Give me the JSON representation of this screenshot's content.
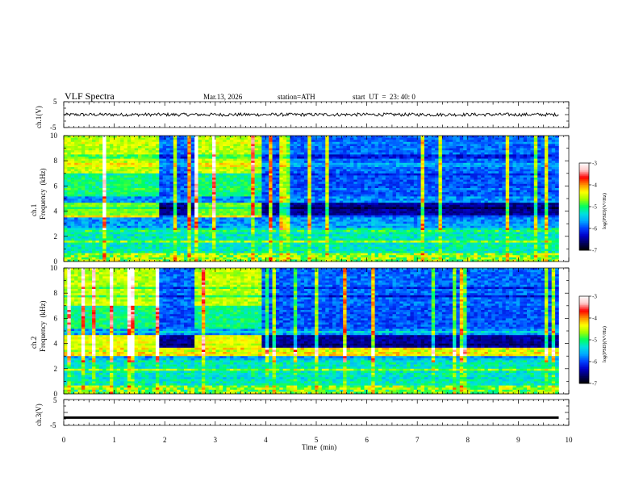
{
  "header": {
    "title": "VLF  Spectra",
    "date": "Mar.13, 2026",
    "station": "station=ATH",
    "start": "start  UT  =  23: 40: 0"
  },
  "colors": {
    "colormap": [
      "#000000",
      "#000060",
      "#0000c8",
      "#0040ff",
      "#00a8ff",
      "#00e0e0",
      "#00ff60",
      "#a0ff00",
      "#ffff00",
      "#ff9000",
      "#ff0000",
      "#ffc8c8",
      "#ffffff"
    ],
    "waveform": "#000000"
  },
  "chart_data": [
    {
      "type": "line",
      "panel": "ch1-waveform",
      "ylabel": "ch.1(V)",
      "yticks": [
        "5",
        "-5"
      ],
      "ylim": [
        -5,
        5
      ],
      "xlim": [
        0,
        10
      ],
      "level": 0.0,
      "noise_amplitude": 0.4
    },
    {
      "type": "heatmap",
      "panel": "ch1-spectrogram",
      "ylabel_top": "ch.1",
      "ylabel": "Frequency  (kHz)",
      "yticks": [
        "0",
        "2",
        "4",
        "6",
        "8",
        "10"
      ],
      "ylim": [
        0,
        10
      ],
      "xlim": [
        0,
        9.8
      ],
      "colorbar": {
        "label": "log(PSD)(V²/Hz)",
        "ticks": [
          "-3",
          "-4",
          "-5",
          "-6",
          "-7"
        ],
        "range": [
          -7,
          -3
        ]
      },
      "bright_intervals_min": [
        [
          0,
          1.9
        ],
        [
          2.6,
          3.9
        ]
      ],
      "band_kHz": [
        3.5,
        4.6
      ],
      "band_suppressed_intervals_min": [
        [
          1.9,
          2.6
        ],
        [
          3.9,
          9.8
        ]
      ]
    },
    {
      "type": "heatmap",
      "panel": "ch2-spectrogram",
      "ylabel_top": "ch.2",
      "ylabel": "Frequency  (kHz)",
      "yticks": [
        "0",
        "2",
        "4",
        "6",
        "8",
        "10"
      ],
      "ylim": [
        0,
        10
      ],
      "xlim": [
        0,
        9.8
      ],
      "colorbar": {
        "label": "log(PSD)(V²/Hz)",
        "ticks": [
          "-3",
          "-4",
          "-5",
          "-6",
          "-7"
        ],
        "range": [
          -7,
          -3
        ]
      },
      "bright_intervals_min": [
        [
          0,
          1.9
        ],
        [
          2.6,
          3.9
        ]
      ],
      "band_kHz": [
        3.5,
        4.6
      ],
      "band_suppressed_intervals_min": [
        [
          1.9,
          2.6
        ],
        [
          3.9,
          9.8
        ]
      ]
    },
    {
      "type": "line",
      "panel": "ch3-waveform",
      "ylabel": "ch.3(V)",
      "yticks": [
        "5",
        "-5"
      ],
      "ylim": [
        -5,
        5
      ],
      "xlim": [
        0,
        10
      ],
      "level": -2.0,
      "noise_amplitude": 0.05,
      "xlabel": "Time  (min)",
      "xticks": [
        "0",
        "1",
        "2",
        "3",
        "4",
        "5",
        "6",
        "7",
        "8",
        "9",
        "10"
      ]
    }
  ]
}
